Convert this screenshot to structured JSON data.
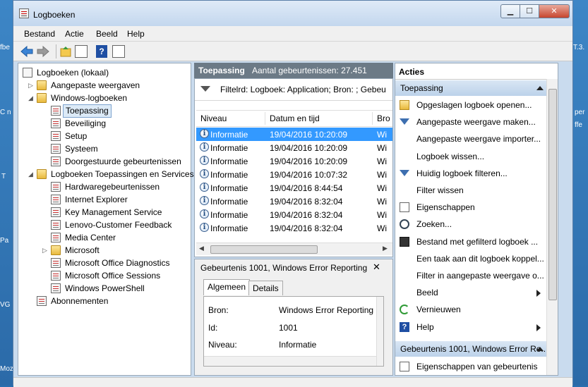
{
  "window": {
    "title": "Logboeken"
  },
  "menu": [
    "Bestand",
    "Actie",
    "Beeld",
    "Help"
  ],
  "tree": {
    "nodes": [
      {
        "label": "Logboeken (lokaal)",
        "level": 0,
        "icon": "root",
        "arrow": ""
      },
      {
        "label": "Aangepaste weergaven",
        "level": 1,
        "icon": "folder",
        "arrow": "collapsed"
      },
      {
        "label": "Windows-logboeken",
        "level": 1,
        "icon": "folder",
        "arrow": "expanded"
      },
      {
        "label": "Toepassing",
        "level": 2,
        "icon": "log",
        "arrow": "",
        "selected": true
      },
      {
        "label": "Beveiliging",
        "level": 2,
        "icon": "log",
        "arrow": ""
      },
      {
        "label": "Setup",
        "level": 2,
        "icon": "log",
        "arrow": ""
      },
      {
        "label": "Systeem",
        "level": 2,
        "icon": "log",
        "arrow": ""
      },
      {
        "label": "Doorgestuurde gebeurtenissen",
        "level": 2,
        "icon": "log",
        "arrow": ""
      },
      {
        "label": "Logboeken Toepassingen en Services",
        "level": 1,
        "icon": "folder",
        "arrow": "expanded"
      },
      {
        "label": "Hardwaregebeurtenissen",
        "level": 2,
        "icon": "log",
        "arrow": ""
      },
      {
        "label": "Internet Explorer",
        "level": 2,
        "icon": "log",
        "arrow": ""
      },
      {
        "label": "Key Management Service",
        "level": 2,
        "icon": "log",
        "arrow": ""
      },
      {
        "label": "Lenovo-Customer Feedback",
        "level": 2,
        "icon": "log",
        "arrow": ""
      },
      {
        "label": "Media Center",
        "level": 2,
        "icon": "log",
        "arrow": ""
      },
      {
        "label": "Microsoft",
        "level": 2,
        "icon": "folder",
        "arrow": "collapsed"
      },
      {
        "label": "Microsoft Office Diagnostics",
        "level": 2,
        "icon": "log",
        "arrow": ""
      },
      {
        "label": "Microsoft Office Sessions",
        "level": 2,
        "icon": "log",
        "arrow": ""
      },
      {
        "label": "Windows PowerShell",
        "level": 2,
        "icon": "log",
        "arrow": ""
      },
      {
        "label": "Abonnementen",
        "level": 1,
        "icon": "log",
        "arrow": ""
      }
    ]
  },
  "middle": {
    "header_title": "Toepassing",
    "header_count": "Aantal gebeurtenissen: 27.451",
    "filter_text": "Filtelrd: Logboek: Application; Bron: ; Gebeu",
    "columns": [
      "Niveau",
      "Datum en tijd",
      "Bro"
    ],
    "rows": [
      {
        "level": "Informatie",
        "datetime": "19/04/2016 10:20:09",
        "source": "Wi",
        "selected": true
      },
      {
        "level": "Informatie",
        "datetime": "19/04/2016 10:20:09",
        "source": "Wi"
      },
      {
        "level": "Informatie",
        "datetime": "19/04/2016 10:20:09",
        "source": "Wi"
      },
      {
        "level": "Informatie",
        "datetime": "19/04/2016 10:07:32",
        "source": "Wi"
      },
      {
        "level": "Informatie",
        "datetime": "19/04/2016 8:44:54",
        "source": "Wi"
      },
      {
        "level": "Informatie",
        "datetime": "19/04/2016 8:32:04",
        "source": "Wi"
      },
      {
        "level": "Informatie",
        "datetime": "19/04/2016 8:32:04",
        "source": "Wi"
      },
      {
        "level": "Informatie",
        "datetime": "19/04/2016 8:32:04",
        "source": "Wi"
      }
    ]
  },
  "detail": {
    "title": "Gebeurtenis 1001, Windows Error Reporting",
    "close": "✕",
    "tabs": [
      "Algemeen",
      "Details"
    ],
    "fields": [
      {
        "key": "Bron:",
        "value": "Windows Error Reporting"
      },
      {
        "key": "Id:",
        "value": "1001"
      },
      {
        "key": "Niveau:",
        "value": "Informatie"
      }
    ]
  },
  "actions": {
    "header": "Acties",
    "section1": "Toepassing",
    "items1": [
      {
        "label": "Opgeslagen logboek openen...",
        "icon": "open"
      },
      {
        "label": "Aangepaste weergave maken...",
        "icon": "filter"
      },
      {
        "label": "Aangepaste weergave importer...",
        "icon": ""
      },
      {
        "label": "Logboek wissen...",
        "icon": ""
      },
      {
        "label": "Huidig logboek filteren...",
        "icon": "filter"
      },
      {
        "label": "Filter wissen",
        "icon": ""
      },
      {
        "label": "Eigenschappen",
        "icon": "props"
      },
      {
        "label": "Zoeken...",
        "icon": "find"
      },
      {
        "label": "Bestand met gefilterd logboek ...",
        "icon": "save"
      },
      {
        "label": "Een taak aan dit logboek koppel...",
        "icon": ""
      },
      {
        "label": "Filter in aangepaste weergave o...",
        "icon": ""
      },
      {
        "label": "Beeld",
        "icon": "",
        "submenu": true
      },
      {
        "label": "Vernieuwen",
        "icon": "refresh"
      },
      {
        "label": "Help",
        "icon": "help",
        "submenu": true
      }
    ],
    "section2": "Gebeurtenis 1001, Windows Error Re...",
    "items2": [
      {
        "label": "Eigenschappen van gebeurtenis",
        "icon": "props"
      }
    ]
  },
  "desktop": {
    "left_labels": [
      "fbe",
      "C n",
      "T",
      "Pa",
      "VG",
      "Moz"
    ],
    "right_labels": [
      "T.3.",
      "per",
      "ffe"
    ]
  },
  "colors": {
    "selection": "#3399ff",
    "header_dark": "#6c7a86",
    "section": "#c9dbee"
  }
}
